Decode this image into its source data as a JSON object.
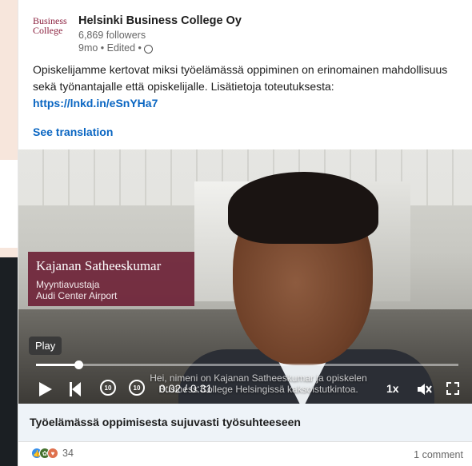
{
  "post": {
    "company_name": "Helsinki Business College Oy",
    "logo_line1": "Business",
    "logo_line2": "College",
    "followers": "6,869 followers",
    "meta": "9mo • Edited •",
    "text": "Opiskelijamme kertovat miksi työelämässä oppiminen on erinomainen mahdollisuus sekä työnantajalle että opiskelijalle. Lisätietoja toteutuksesta:",
    "link": "https://lnkd.in/eSnYHa7",
    "see_translation": "See translation"
  },
  "video": {
    "lower_third": {
      "name": "Kajanan Satheeskumar",
      "role": "Myyntiavustaja",
      "company": "Audi Center Airport"
    },
    "tooltip": "Play",
    "subtitle_line1": "Hei, nimeni on Kajanan Satheeskumar ja opiskelen",
    "subtitle_line2": "Business College Helsingissä kaksoistutkintoa.",
    "time": "0:02 / 0:31",
    "speed": "1x",
    "progress": 0.1,
    "rewind_label": "10",
    "forward_label": "10"
  },
  "article": {
    "title": "Työelämässä oppimisesta sujuvasti työsuhteeseen"
  },
  "social": {
    "reaction_count": "34",
    "comments": "1 comment"
  },
  "colors": {
    "link": "#0a66c2",
    "lower_third_bg": "#6e2337",
    "brand": "#8a1f3d"
  }
}
